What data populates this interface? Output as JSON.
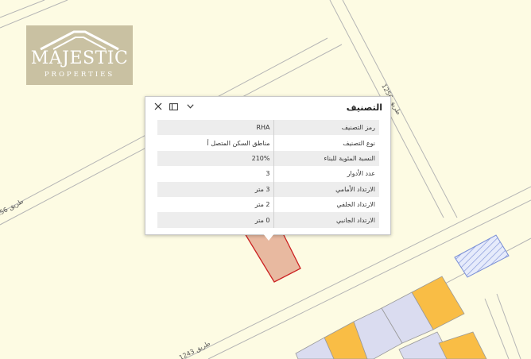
{
  "logo": {
    "title": "MAJESTIC",
    "subtitle": "PROPERTIES"
  },
  "roads": {
    "label_1256_left": "طريق 1256",
    "label_1256_right": "طريق 1256",
    "label_1243": "طريق 1243"
  },
  "popup": {
    "title": "التصنيف",
    "rows": [
      {
        "name": "رمز التصنيف",
        "value": "RHA"
      },
      {
        "name": "نوع التصنيف",
        "value": "مناطق السكن المتصل أ"
      },
      {
        "name": "النسبة المئوية للبناء",
        "value": "210%"
      },
      {
        "name": "عدد الأدوار",
        "value": "3"
      },
      {
        "name": "الارتداد الأمامي",
        "value": "3 متر"
      },
      {
        "name": "الارتداد الخلفي",
        "value": "2 متر"
      },
      {
        "name": "الارتداد الجانبي",
        "value": "0 متر"
      }
    ]
  },
  "colors": {
    "background": "#fdfbe3",
    "selected_parcel_fill": "#e8b9a0",
    "selected_parcel_border": "#cc2222",
    "building_orange": "#f9bd45",
    "building_lavender": "#dadcf0",
    "hatched_blue": "#7a8fd6",
    "road_line": "#b5b5b5"
  },
  "icons": {
    "close": "close-icon",
    "dock": "dock-icon",
    "collapse": "chevron-down-icon"
  }
}
